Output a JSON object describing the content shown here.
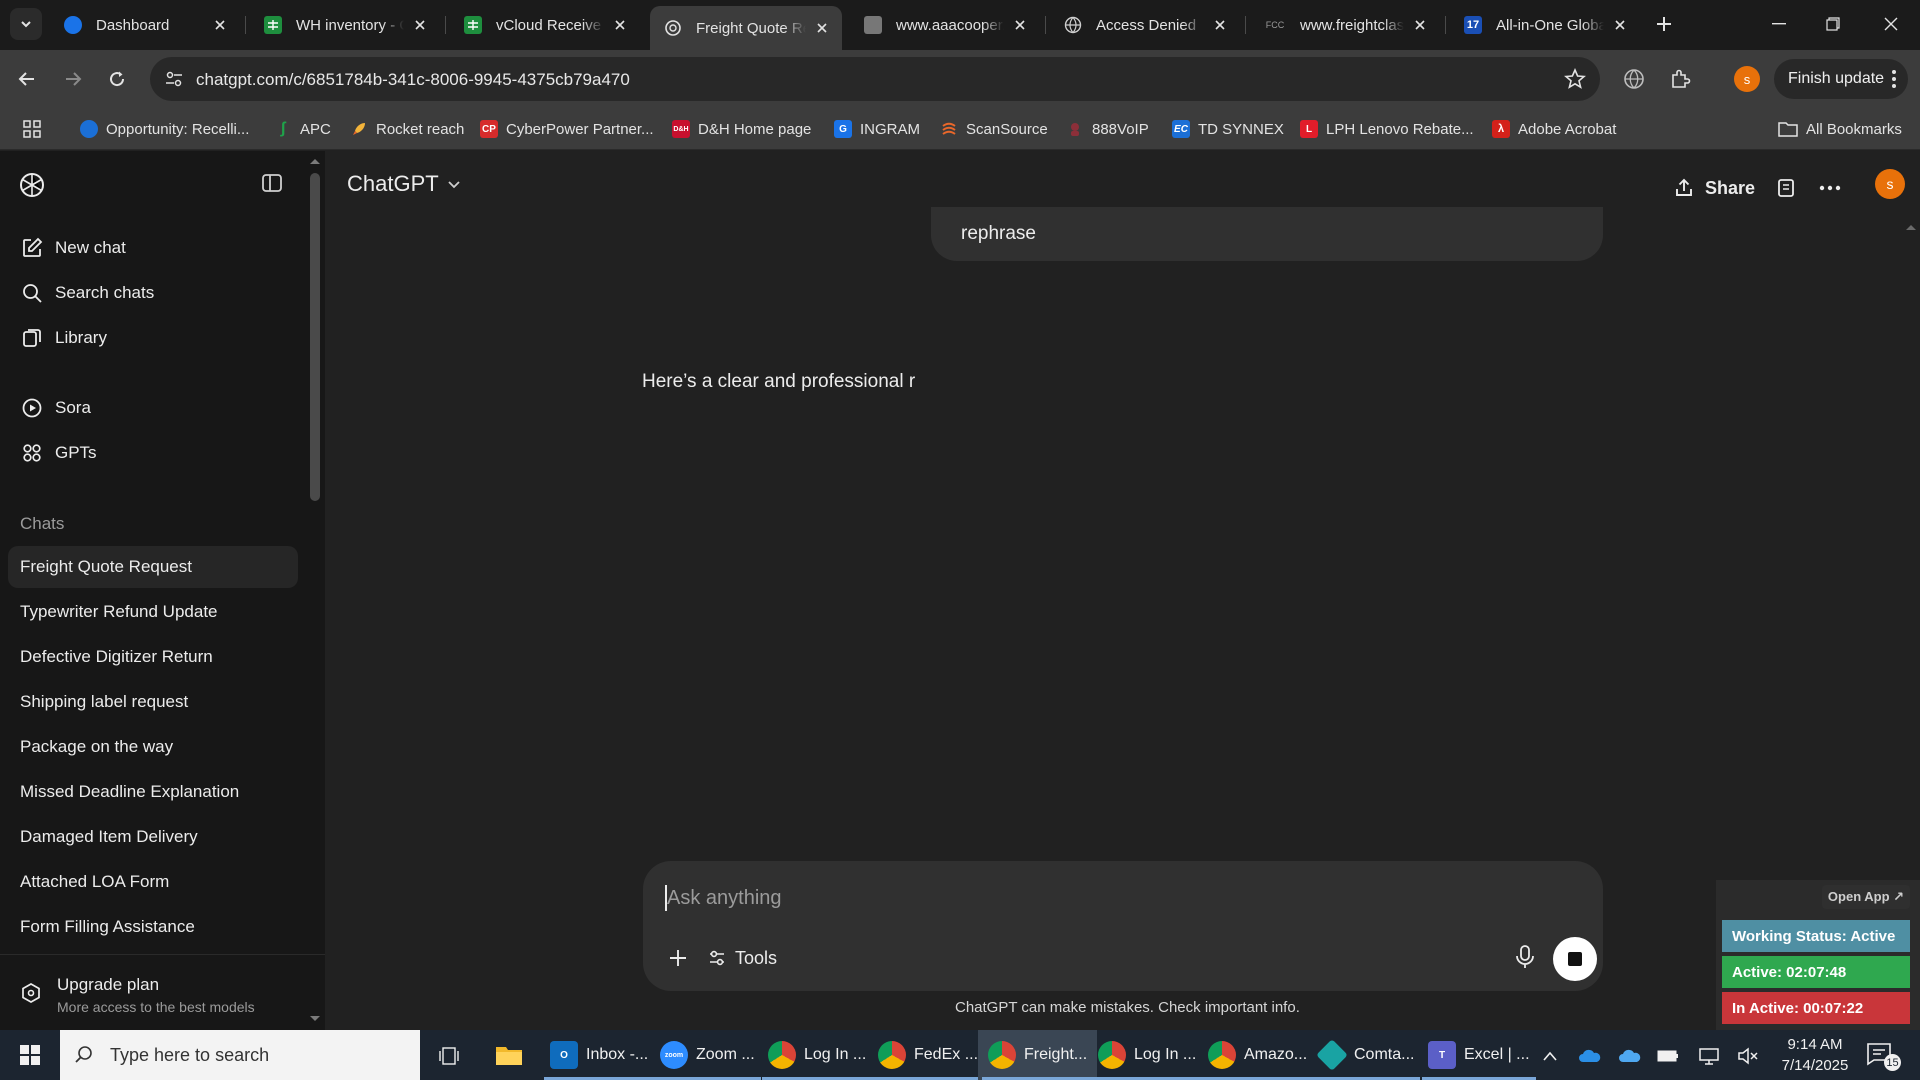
{
  "browser": {
    "tabs": [
      {
        "title": "Dashboard",
        "favicon": "dashboard-icon",
        "active": false
      },
      {
        "title": "WH inventory - Google Sheets",
        "favicon": "sheets-icon",
        "active": false
      },
      {
        "title": "vCloud Receive Form",
        "favicon": "sheets-icon",
        "active": false
      },
      {
        "title": "Freight Quote Request",
        "favicon": "chatgpt-icon",
        "active": true
      },
      {
        "title": "www.aaacooper.com",
        "favicon": "aaacooper-icon",
        "active": false
      },
      {
        "title": "Access Denied",
        "favicon": "globe-icon",
        "active": false
      },
      {
        "title": "www.freightclass.com",
        "favicon": "fcc-icon",
        "active": false
      },
      {
        "title": "All-in-One Global",
        "favicon": "17track-icon",
        "active": false
      }
    ],
    "url": "chatgpt.com/c/6851784b-341c-8006-9945-4375cb79a470",
    "profile_initial": "s",
    "finish_update_label": "Finish update",
    "bookmarks": [
      {
        "label": "Opportunity: Recelli...",
        "color": "#1b6fd6"
      },
      {
        "label": "APC",
        "color": "#1fa34a"
      },
      {
        "label": "Rocket reach",
        "color": "#f08c1a"
      },
      {
        "label": "CyberPower Partner...",
        "color": "#d62b2b",
        "text": "CP"
      },
      {
        "label": "D&H Home page",
        "color": "#c8102e"
      },
      {
        "label": "INGRAM",
        "color": "#1a73e8"
      },
      {
        "label": "ScanSource",
        "color": "#e9672a"
      },
      {
        "label": "888VoIP",
        "color": "#8c2f39"
      },
      {
        "label": "TD SYNNEX",
        "color": "#1b6fd6",
        "text": "EC"
      },
      {
        "label": "LPH Lenovo Rebate...",
        "color": "#e11d2a",
        "text": "L"
      },
      {
        "label": "Adobe Acrobat",
        "color": "#d4211a"
      }
    ],
    "all_bookmarks_label": "All Bookmarks"
  },
  "sidebar": {
    "nav": [
      {
        "label": "New chat",
        "icon": "new-chat-icon"
      },
      {
        "label": "Search chats",
        "icon": "search-icon"
      },
      {
        "label": "Library",
        "icon": "library-icon"
      },
      {
        "label": "Sora",
        "icon": "sora-icon"
      },
      {
        "label": "GPTs",
        "icon": "gpts-icon"
      }
    ],
    "chats_heading": "Chats",
    "chats": [
      "Freight Quote Request",
      "Typewriter Refund Update",
      "Defective Digitizer Return",
      "Shipping label request",
      "Package on the way",
      "Missed Deadline Explanation",
      "Damaged Item Delivery",
      "Attached LOA Form",
      "Form Filling Assistance"
    ],
    "upgrade_title": "Upgrade plan",
    "upgrade_subtitle": "More access to the best models"
  },
  "main": {
    "model_name": "ChatGPT",
    "share_label": "Share",
    "avatar_initial": "s",
    "user_message": "rephrase",
    "assistant_message": "Here’s a clear and professional r",
    "composer_placeholder": "Ask anything",
    "tools_label": "Tools",
    "disclaimer": "ChatGPT can make mistakes. Check important info."
  },
  "status_widget": {
    "open_app_label": "Open App ↗",
    "working_status": "Working Status: Active",
    "active_time": "Active: 02:07:48",
    "inactive_time": "In Active: 00:07:22",
    "colors": {
      "working": "#4f8fa3",
      "active": "#2fa84f",
      "inactive": "#c9363a"
    }
  },
  "taskbar": {
    "search_placeholder": "Type here to search",
    "apps": [
      {
        "label": "Inbox -...",
        "icon": "outlook-icon",
        "color": "#0f6cbd",
        "text": "O"
      },
      {
        "label": "Zoom ...",
        "icon": "zoom-icon",
        "color": "#2d8cff",
        "text": "zoom"
      },
      {
        "label": "Log In ...",
        "icon": "chrome-icon",
        "color": "#db4437"
      },
      {
        "label": "FedEx ...",
        "icon": "chrome-icon",
        "color": "#db4437"
      },
      {
        "label": "Freight...",
        "icon": "chrome-icon",
        "color": "#db4437"
      },
      {
        "label": "Log In ...",
        "icon": "chrome-icon",
        "color": "#db4437"
      },
      {
        "label": "Amazo...",
        "icon": "chrome-icon",
        "color": "#db4437"
      },
      {
        "label": "Comta...",
        "icon": "comtrade-icon",
        "color": "#19a3a3"
      },
      {
        "label": "Excel | ...",
        "icon": "teams-icon",
        "color": "#5b5fc7",
        "text": "T"
      }
    ],
    "time": "9:14 AM",
    "date": "7/14/2025",
    "notification_count": "15"
  }
}
